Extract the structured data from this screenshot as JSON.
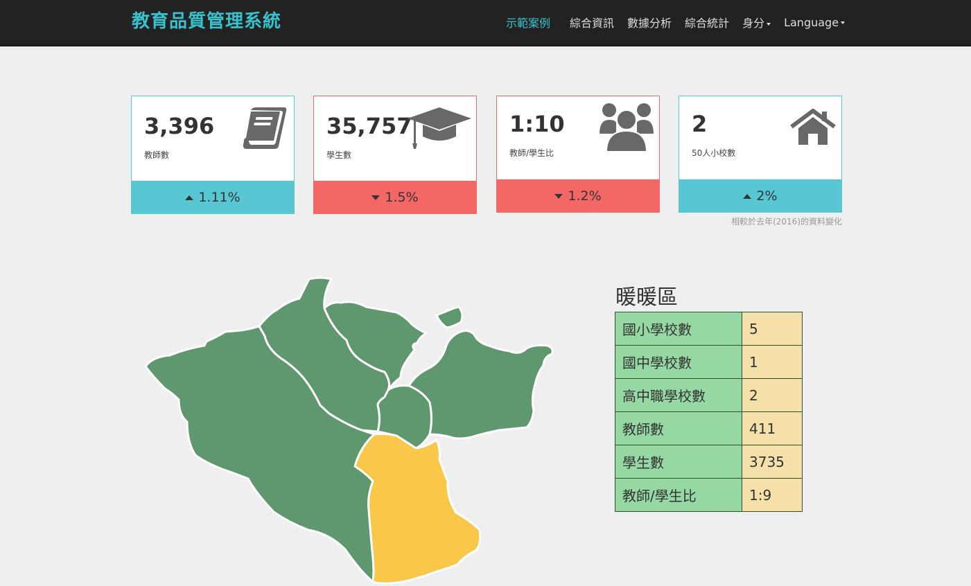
{
  "app": {
    "brand": "教育品質管理系統"
  },
  "nav": {
    "items": [
      {
        "label": "示範案例",
        "active": true
      },
      {
        "label": "綜合資訊"
      },
      {
        "label": "數據分析"
      },
      {
        "label": "綜合統計"
      },
      {
        "label": "身分",
        "dropdown": true
      },
      {
        "label": "Language",
        "dropdown": true
      }
    ]
  },
  "stats": [
    {
      "value": "3,396",
      "label": "教師數",
      "change": "1.11%",
      "direction": "up",
      "icon": "book-icon",
      "color": "#58c7d3"
    },
    {
      "value": "35,757",
      "label": "學生數",
      "change": "1.5%",
      "direction": "down",
      "icon": "graduation-cap-icon",
      "color": "#f46767"
    },
    {
      "value": "1:10",
      "label": "教師/學生比",
      "change": "1.2%",
      "direction": "down",
      "icon": "users-icon",
      "color": "#f46767"
    },
    {
      "value": "2",
      "label": "50人小校數",
      "change": "2%",
      "direction": "up",
      "icon": "home-icon",
      "color": "#58c7d3"
    }
  ],
  "compare_note": "相較於去年(2016)的資料變化",
  "map": {
    "highlight_color": "#f9c84a",
    "base_color": "#5f976e"
  },
  "region": {
    "title": "暖暖區",
    "rows": [
      {
        "key": "國小學校數",
        "value": "5"
      },
      {
        "key": "國中學校數",
        "value": "1"
      },
      {
        "key": "高中職學校數",
        "value": "2"
      },
      {
        "key": "教師數",
        "value": "411"
      },
      {
        "key": "學生數",
        "value": "3735"
      },
      {
        "key": "教師/學生比",
        "value": "1:9"
      }
    ]
  }
}
